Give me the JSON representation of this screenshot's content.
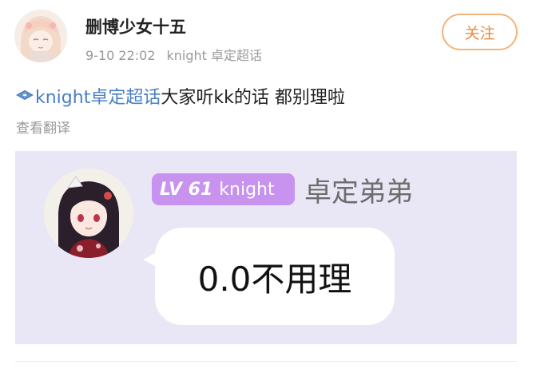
{
  "post": {
    "author": {
      "name": "删博少女十五"
    },
    "timestamp": "9-10 22:02",
    "source": "knight 卓定超话",
    "follow_label": "关注",
    "topic": "knight卓定超话",
    "content": "大家听kk的话 都别理啦",
    "translate_label": "查看翻译"
  },
  "card": {
    "level": "LV 61",
    "badge_name": "knight",
    "role_name": "卓定弟弟",
    "message": "0.0不用理"
  },
  "colors": {
    "topic_blue": "#4a7fc4",
    "follow_orange": "#ee8a3f",
    "card_bg": "#e9e7f5",
    "badge_purple": "#c892ef"
  }
}
